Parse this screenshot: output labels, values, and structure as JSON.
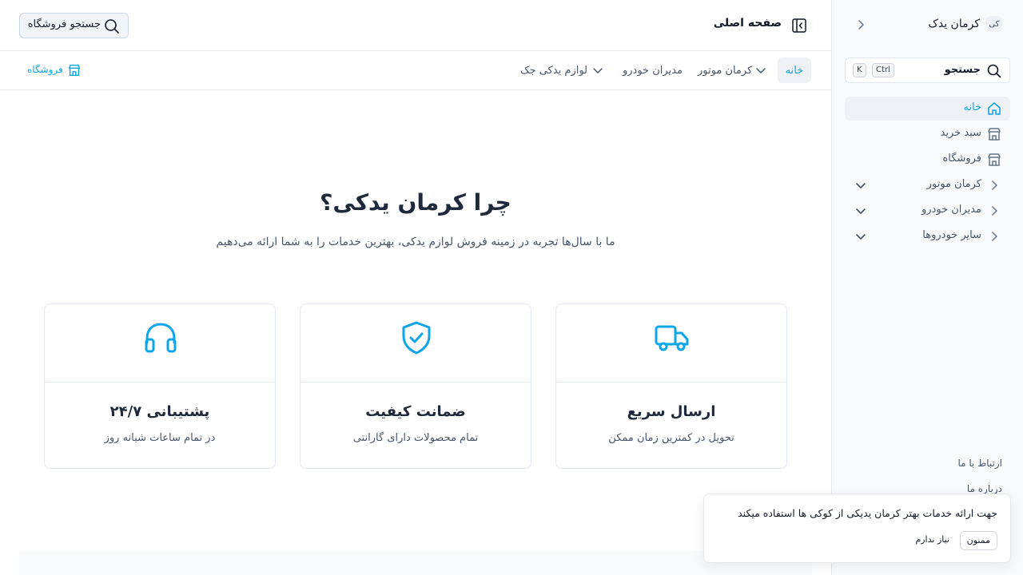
{
  "app": {
    "brand_badge": "کی",
    "brand_name": "کرمان یدک"
  },
  "sidebar": {
    "search_label": "جستجو",
    "shortcut_ctrl": "Ctrl",
    "shortcut_key": "K",
    "items": [
      {
        "label": "خانه",
        "icon": "home-icon"
      },
      {
        "label": "سبد خرید",
        "icon": "store-icon"
      },
      {
        "label": "فروشگاه",
        "icon": "store-icon"
      },
      {
        "label": "کرمان موتور",
        "icon": "chevron-right-icon"
      },
      {
        "label": "مدیران خودرو",
        "icon": "chevron-right-icon"
      },
      {
        "label": "سایر خودروها",
        "icon": "chevron-right-icon"
      }
    ],
    "footer": {
      "contact": "ارتباط با ما",
      "about": "درباره ما"
    }
  },
  "header": {
    "page_title": "صفحه اصلی",
    "store_search": "جستجو فروشگاه"
  },
  "subnav": {
    "tabs": [
      {
        "label": "خانه"
      },
      {
        "label": "کرمان موتور"
      },
      {
        "label": "مدیران خودرو"
      },
      {
        "label": "لوازم یدکی جک"
      }
    ],
    "store_link": "فروشگاه"
  },
  "hero": {
    "title": "چرا کرمان یدکی؟",
    "subtitle": "ما با سال‌ها تجربه در زمینه فروش لوازم یدکی، بهترین خدمات را به شما ارائه می‌دهیم"
  },
  "features": [
    {
      "title": "ارسال سریع",
      "desc": "تحویل در کمترین زمان ممکن",
      "icon": "truck-icon"
    },
    {
      "title": "ضمانت کیفیت",
      "desc": "تمام محصولات دارای گارانتی",
      "icon": "shield-check-icon"
    },
    {
      "title": "پشتیبانی ۲۴/۷",
      "desc": "در تمام ساعات شبانه روز",
      "icon": "headphones-icon"
    }
  ],
  "cookie": {
    "message": "جهت ارائه خدمات بهتر کرمان یدیکی از کوکی ها استفاده میکند",
    "accept": "ممنون",
    "decline": "نیاز ندارم"
  },
  "colors": {
    "accent": "#0ea5e9",
    "text": "#1e293b",
    "muted": "#475569",
    "border": "#e2e8f0"
  }
}
